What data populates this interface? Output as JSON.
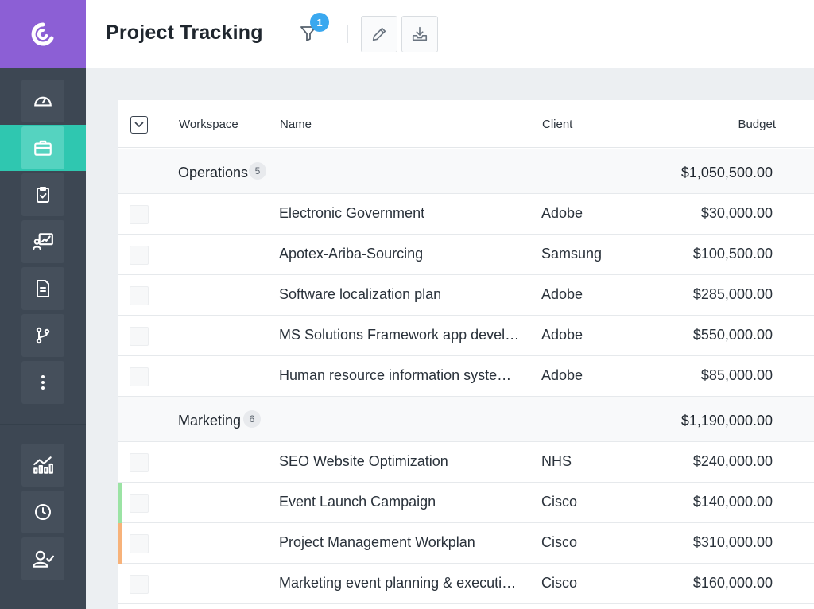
{
  "header": {
    "title": "Project Tracking",
    "filter_count": "1"
  },
  "sidebar": {
    "items": [
      {
        "icon": "dashboard-icon"
      },
      {
        "icon": "briefcase-icon",
        "active": true
      },
      {
        "icon": "clipboard-check-icon"
      },
      {
        "icon": "presentation-chart-icon"
      },
      {
        "icon": "document-icon"
      },
      {
        "icon": "branch-icon"
      },
      {
        "icon": "more-icon"
      },
      {
        "icon": "analytics-icon"
      },
      {
        "icon": "clock-icon"
      },
      {
        "icon": "user-check-icon"
      }
    ]
  },
  "table": {
    "columns": {
      "workspace": "Workspace",
      "name": "Name",
      "client": "Client",
      "budget": "Budget"
    },
    "groups": [
      {
        "name": "Operations",
        "count": "5",
        "total": "$1,050,500.00",
        "rows": [
          {
            "name": "Electronic Government",
            "client": "Adobe",
            "budget": "$30,000.00"
          },
          {
            "name": "Apotex-Ariba-Sourcing",
            "client": "Samsung",
            "budget": "$100,500.00"
          },
          {
            "name": "Software localization plan",
            "client": "Adobe",
            "budget": "$285,000.00"
          },
          {
            "name": "MS Solutions Framework app devel…",
            "client": "Adobe",
            "budget": "$550,000.00"
          },
          {
            "name": "Human resource information syste…",
            "client": "Adobe",
            "budget": "$85,000.00"
          }
        ]
      },
      {
        "name": "Marketing",
        "count": "6",
        "total": "$1,190,000.00",
        "rows": [
          {
            "name": "SEO Website Optimization",
            "client": "NHS",
            "budget": "$240,000.00"
          },
          {
            "name": "Event Launch Campaign",
            "client": "Cisco",
            "budget": "$140,000.00",
            "marker": "#9be3a4"
          },
          {
            "name": "Project Management Workplan",
            "client": "Cisco",
            "budget": "$310,000.00",
            "marker": "#f7b27a"
          },
          {
            "name": "Marketing event planning & executi…",
            "client": "Cisco",
            "budget": "$160,000.00"
          }
        ]
      }
    ]
  },
  "colors": {
    "brand": "#8c5fd5",
    "active_nav": "#2fc7b0",
    "badge": "#3aa8ef",
    "sidebar": "#3d4753"
  }
}
